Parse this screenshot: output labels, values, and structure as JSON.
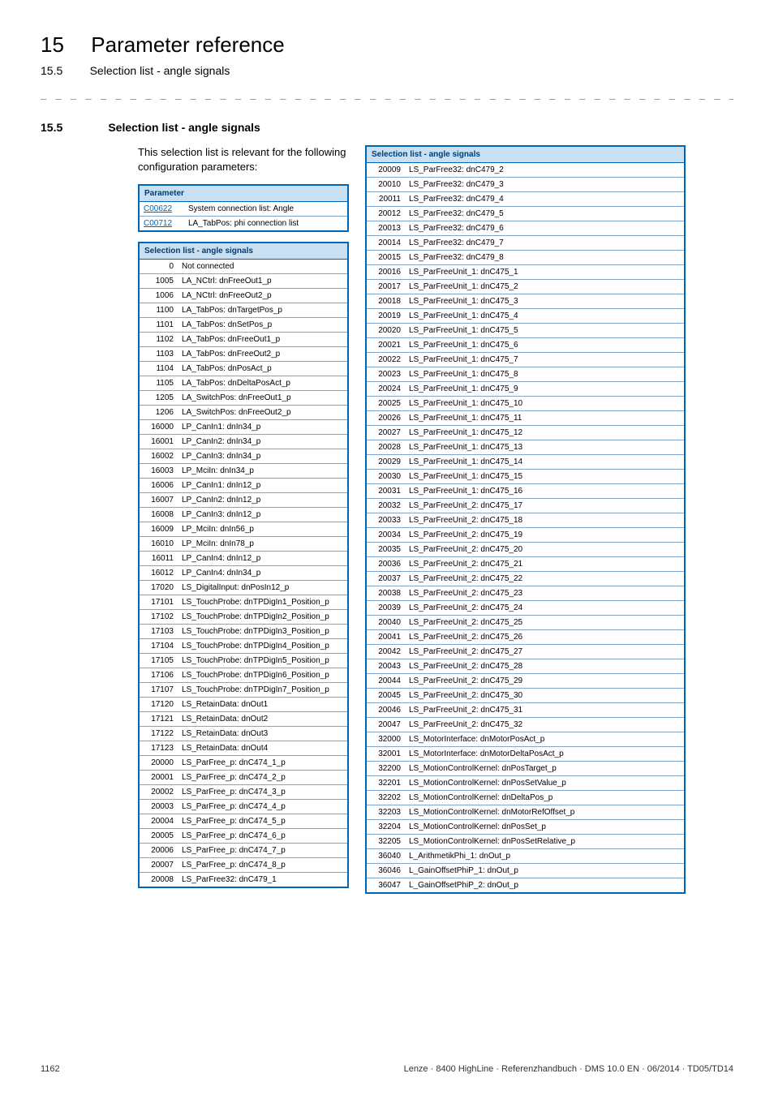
{
  "header": {
    "section_num": "15",
    "section_title": "Parameter reference",
    "sub_num": "15.5",
    "sub_title": "Selection list - angle signals"
  },
  "subsection": {
    "num": "15.5",
    "title": "Selection list - angle signals",
    "intro": "This selection list is relevant for the following configuration parameters:"
  },
  "param_table": {
    "header": "Parameter",
    "rows": [
      {
        "code": "C00622",
        "desc": "System connection list: Angle"
      },
      {
        "code": "C00712",
        "desc": "LA_TabPos: phi connection list"
      }
    ]
  },
  "selection_header": "Selection list - angle signals",
  "selection_left": [
    {
      "n": "0",
      "d": "Not connected"
    },
    {
      "n": "1005",
      "d": "LA_NCtrl: dnFreeOut1_p"
    },
    {
      "n": "1006",
      "d": "LA_NCtrl: dnFreeOut2_p"
    },
    {
      "n": "1100",
      "d": "LA_TabPos: dnTargetPos_p"
    },
    {
      "n": "1101",
      "d": "LA_TabPos: dnSetPos_p"
    },
    {
      "n": "1102",
      "d": "LA_TabPos: dnFreeOut1_p"
    },
    {
      "n": "1103",
      "d": "LA_TabPos: dnFreeOut2_p"
    },
    {
      "n": "1104",
      "d": "LA_TabPos: dnPosAct_p"
    },
    {
      "n": "1105",
      "d": "LA_TabPos: dnDeltaPosAct_p"
    },
    {
      "n": "1205",
      "d": "LA_SwitchPos: dnFreeOut1_p"
    },
    {
      "n": "1206",
      "d": "LA_SwitchPos: dnFreeOut2_p"
    },
    {
      "n": "16000",
      "d": "LP_CanIn1: dnIn34_p"
    },
    {
      "n": "16001",
      "d": "LP_CanIn2: dnIn34_p"
    },
    {
      "n": "16002",
      "d": "LP_CanIn3: dnIn34_p"
    },
    {
      "n": "16003",
      "d": "LP_MciIn: dnIn34_p"
    },
    {
      "n": "16006",
      "d": "LP_CanIn1: dnIn12_p"
    },
    {
      "n": "16007",
      "d": "LP_CanIn2: dnIn12_p"
    },
    {
      "n": "16008",
      "d": "LP_CanIn3: dnIn12_p"
    },
    {
      "n": "16009",
      "d": "LP_MciIn: dnIn56_p"
    },
    {
      "n": "16010",
      "d": "LP_MciIn: dnIn78_p"
    },
    {
      "n": "16011",
      "d": "LP_CanIn4: dnIn12_p"
    },
    {
      "n": "16012",
      "d": "LP_CanIn4: dnIn34_p"
    },
    {
      "n": "17020",
      "d": "LS_DigitalInput: dnPosIn12_p"
    },
    {
      "n": "17101",
      "d": "LS_TouchProbe: dnTPDigIn1_Position_p"
    },
    {
      "n": "17102",
      "d": "LS_TouchProbe: dnTPDigIn2_Position_p"
    },
    {
      "n": "17103",
      "d": "LS_TouchProbe: dnTPDigIn3_Position_p"
    },
    {
      "n": "17104",
      "d": "LS_TouchProbe: dnTPDigIn4_Position_p"
    },
    {
      "n": "17105",
      "d": "LS_TouchProbe: dnTPDigIn5_Position_p"
    },
    {
      "n": "17106",
      "d": "LS_TouchProbe: dnTPDigIn6_Position_p"
    },
    {
      "n": "17107",
      "d": "LS_TouchProbe: dnTPDigIn7_Position_p"
    },
    {
      "n": "17120",
      "d": "LS_RetainData: dnOut1"
    },
    {
      "n": "17121",
      "d": "LS_RetainData: dnOut2"
    },
    {
      "n": "17122",
      "d": "LS_RetainData: dnOut3"
    },
    {
      "n": "17123",
      "d": "LS_RetainData: dnOut4"
    },
    {
      "n": "20000",
      "d": "LS_ParFree_p: dnC474_1_p"
    },
    {
      "n": "20001",
      "d": "LS_ParFree_p: dnC474_2_p"
    },
    {
      "n": "20002",
      "d": "LS_ParFree_p: dnC474_3_p"
    },
    {
      "n": "20003",
      "d": "LS_ParFree_p: dnC474_4_p"
    },
    {
      "n": "20004",
      "d": "LS_ParFree_p: dnC474_5_p"
    },
    {
      "n": "20005",
      "d": "LS_ParFree_p: dnC474_6_p"
    },
    {
      "n": "20006",
      "d": "LS_ParFree_p: dnC474_7_p"
    },
    {
      "n": "20007",
      "d": "LS_ParFree_p: dnC474_8_p"
    },
    {
      "n": "20008",
      "d": "LS_ParFree32: dnC479_1"
    }
  ],
  "selection_right": [
    {
      "n": "20009",
      "d": "LS_ParFree32: dnC479_2"
    },
    {
      "n": "20010",
      "d": "LS_ParFree32: dnC479_3"
    },
    {
      "n": "20011",
      "d": "LS_ParFree32: dnC479_4"
    },
    {
      "n": "20012",
      "d": "LS_ParFree32: dnC479_5"
    },
    {
      "n": "20013",
      "d": "LS_ParFree32: dnC479_6"
    },
    {
      "n": "20014",
      "d": "LS_ParFree32: dnC479_7"
    },
    {
      "n": "20015",
      "d": "LS_ParFree32: dnC479_8"
    },
    {
      "n": "20016",
      "d": "LS_ParFreeUnit_1: dnC475_1"
    },
    {
      "n": "20017",
      "d": "LS_ParFreeUnit_1: dnC475_2"
    },
    {
      "n": "20018",
      "d": "LS_ParFreeUnit_1: dnC475_3"
    },
    {
      "n": "20019",
      "d": "LS_ParFreeUnit_1: dnC475_4"
    },
    {
      "n": "20020",
      "d": "LS_ParFreeUnit_1: dnC475_5"
    },
    {
      "n": "20021",
      "d": "LS_ParFreeUnit_1: dnC475_6"
    },
    {
      "n": "20022",
      "d": "LS_ParFreeUnit_1: dnC475_7"
    },
    {
      "n": "20023",
      "d": "LS_ParFreeUnit_1: dnC475_8"
    },
    {
      "n": "20024",
      "d": "LS_ParFreeUnit_1: dnC475_9"
    },
    {
      "n": "20025",
      "d": "LS_ParFreeUnit_1: dnC475_10"
    },
    {
      "n": "20026",
      "d": "LS_ParFreeUnit_1: dnC475_11"
    },
    {
      "n": "20027",
      "d": "LS_ParFreeUnit_1: dnC475_12"
    },
    {
      "n": "20028",
      "d": "LS_ParFreeUnit_1: dnC475_13"
    },
    {
      "n": "20029",
      "d": "LS_ParFreeUnit_1: dnC475_14"
    },
    {
      "n": "20030",
      "d": "LS_ParFreeUnit_1: dnC475_15"
    },
    {
      "n": "20031",
      "d": "LS_ParFreeUnit_1: dnC475_16"
    },
    {
      "n": "20032",
      "d": "LS_ParFreeUnit_2: dnC475_17"
    },
    {
      "n": "20033",
      "d": "LS_ParFreeUnit_2: dnC475_18"
    },
    {
      "n": "20034",
      "d": "LS_ParFreeUnit_2: dnC475_19"
    },
    {
      "n": "20035",
      "d": "LS_ParFreeUnit_2: dnC475_20"
    },
    {
      "n": "20036",
      "d": "LS_ParFreeUnit_2: dnC475_21"
    },
    {
      "n": "20037",
      "d": "LS_ParFreeUnit_2: dnC475_22"
    },
    {
      "n": "20038",
      "d": "LS_ParFreeUnit_2: dnC475_23"
    },
    {
      "n": "20039",
      "d": "LS_ParFreeUnit_2: dnC475_24"
    },
    {
      "n": "20040",
      "d": "LS_ParFreeUnit_2: dnC475_25"
    },
    {
      "n": "20041",
      "d": "LS_ParFreeUnit_2: dnC475_26"
    },
    {
      "n": "20042",
      "d": "LS_ParFreeUnit_2: dnC475_27"
    },
    {
      "n": "20043",
      "d": "LS_ParFreeUnit_2: dnC475_28"
    },
    {
      "n": "20044",
      "d": "LS_ParFreeUnit_2: dnC475_29"
    },
    {
      "n": "20045",
      "d": "LS_ParFreeUnit_2: dnC475_30"
    },
    {
      "n": "20046",
      "d": "LS_ParFreeUnit_2: dnC475_31"
    },
    {
      "n": "20047",
      "d": "LS_ParFreeUnit_2: dnC475_32"
    },
    {
      "n": "32000",
      "d": "LS_MotorInterface: dnMotorPosAct_p"
    },
    {
      "n": "32001",
      "d": "LS_MotorInterface: dnMotorDeltaPosAct_p"
    },
    {
      "n": "32200",
      "d": "LS_MotionControlKernel: dnPosTarget_p"
    },
    {
      "n": "32201",
      "d": "LS_MotionControlKernel: dnPosSetValue_p"
    },
    {
      "n": "32202",
      "d": "LS_MotionControlKernel: dnDeltaPos_p"
    },
    {
      "n": "32203",
      "d": "LS_MotionControlKernel: dnMotorRefOffset_p"
    },
    {
      "n": "32204",
      "d": "LS_MotionControlKernel: dnPosSet_p"
    },
    {
      "n": "32205",
      "d": "LS_MotionControlKernel: dnPosSetRelative_p"
    },
    {
      "n": "36040",
      "d": "L_ArithmetikPhi_1: dnOut_p"
    },
    {
      "n": "36046",
      "d": "L_GainOffsetPhiP_1: dnOut_p"
    },
    {
      "n": "36047",
      "d": "L_GainOffsetPhiP_2: dnOut_p"
    }
  ],
  "footer": {
    "page": "1162",
    "info": "Lenze · 8400 HighLine · Referenzhandbuch · DMS 10.0 EN · 06/2014 · TD05/TD14"
  }
}
